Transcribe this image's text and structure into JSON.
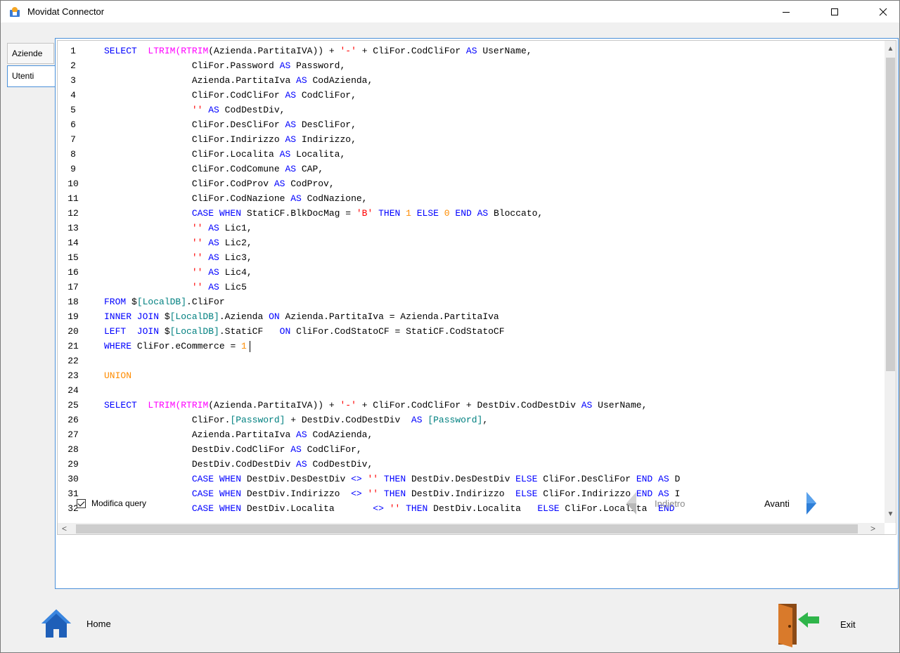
{
  "window": {
    "title": "Movidat Connector",
    "minimize_glyph": "—",
    "maximize_glyph": "☐",
    "close_glyph": "✕"
  },
  "tabs": [
    {
      "label": "Aziende"
    },
    {
      "label": "Utenti"
    }
  ],
  "editor": {
    "lines": [
      {
        "n": "1"
      },
      {
        "n": "2"
      },
      {
        "n": "3"
      },
      {
        "n": "4"
      },
      {
        "n": "5"
      },
      {
        "n": "6"
      },
      {
        "n": "7"
      },
      {
        "n": "8"
      },
      {
        "n": "9"
      },
      {
        "n": "10"
      },
      {
        "n": "11"
      },
      {
        "n": "12"
      },
      {
        "n": "13"
      },
      {
        "n": "14"
      },
      {
        "n": "15"
      },
      {
        "n": "16"
      },
      {
        "n": "17"
      },
      {
        "n": "18"
      },
      {
        "n": "19"
      },
      {
        "n": "20"
      },
      {
        "n": "21"
      },
      {
        "n": "22"
      },
      {
        "n": "23"
      },
      {
        "n": "24"
      },
      {
        "n": "25"
      },
      {
        "n": "26"
      },
      {
        "n": "27"
      },
      {
        "n": "28"
      },
      {
        "n": "29"
      },
      {
        "n": "30"
      },
      {
        "n": "31"
      },
      {
        "n": "32"
      }
    ],
    "code": [
      [
        [
          "kw",
          "SELECT"
        ],
        [
          "",
          "  "
        ],
        [
          "fn",
          "LTRIM"
        ],
        [
          "",
          ""
        ],
        [
          "fn",
          "(RTRIM"
        ],
        [
          "",
          "(Azienda.PartitaIVA)) + "
        ],
        [
          "str",
          "'-'"
        ],
        [
          "",
          " + CliFor.CodCliFor "
        ],
        [
          "kw",
          "AS"
        ],
        [
          "",
          " UserName,"
        ]
      ],
      [
        [
          "",
          "                CliFor.Password "
        ],
        [
          "kw",
          "AS"
        ],
        [
          "",
          " Password,"
        ]
      ],
      [
        [
          "",
          "                Azienda.PartitaIva "
        ],
        [
          "kw",
          "AS"
        ],
        [
          "",
          " CodAzienda,"
        ]
      ],
      [
        [
          "",
          "                CliFor.CodCliFor "
        ],
        [
          "kw",
          "AS"
        ],
        [
          "",
          " CodCliFor,"
        ]
      ],
      [
        [
          "",
          "                "
        ],
        [
          "str",
          "''"
        ],
        [
          "",
          " "
        ],
        [
          "kw",
          "AS"
        ],
        [
          "",
          " CodDestDiv,"
        ]
      ],
      [
        [
          "",
          "                CliFor.DesCliFor "
        ],
        [
          "kw",
          "AS"
        ],
        [
          "",
          " DesCliFor,"
        ]
      ],
      [
        [
          "",
          "                CliFor.Indirizzo "
        ],
        [
          "kw",
          "AS"
        ],
        [
          "",
          " Indirizzo,"
        ]
      ],
      [
        [
          "",
          "                CliFor.Localita "
        ],
        [
          "kw",
          "AS"
        ],
        [
          "",
          " Localita,"
        ]
      ],
      [
        [
          "",
          "                CliFor.CodComune "
        ],
        [
          "kw",
          "AS"
        ],
        [
          "",
          " CAP,"
        ]
      ],
      [
        [
          "",
          "                CliFor.CodProv "
        ],
        [
          "kw",
          "AS"
        ],
        [
          "",
          " CodProv,"
        ]
      ],
      [
        [
          "",
          "                CliFor.CodNazione "
        ],
        [
          "kw",
          "AS"
        ],
        [
          "",
          " CodNazione,"
        ]
      ],
      [
        [
          "",
          "                "
        ],
        [
          "kw",
          "CASE WHEN"
        ],
        [
          "",
          " StatiCF.BlkDocMag = "
        ],
        [
          "str",
          "'B'"
        ],
        [
          "",
          " "
        ],
        [
          "kw",
          "THEN"
        ],
        [
          "",
          " "
        ],
        [
          "num",
          "1"
        ],
        [
          "",
          " "
        ],
        [
          "kw",
          "ELSE"
        ],
        [
          "",
          " "
        ],
        [
          "num",
          "0"
        ],
        [
          "",
          " "
        ],
        [
          "kw",
          "END AS"
        ],
        [
          "",
          " Bloccato,"
        ]
      ],
      [
        [
          "",
          "                "
        ],
        [
          "str",
          "''"
        ],
        [
          "",
          " "
        ],
        [
          "kw",
          "AS"
        ],
        [
          "",
          " Lic1,"
        ]
      ],
      [
        [
          "",
          "                "
        ],
        [
          "str",
          "''"
        ],
        [
          "",
          " "
        ],
        [
          "kw",
          "AS"
        ],
        [
          "",
          " Lic2,"
        ]
      ],
      [
        [
          "",
          "                "
        ],
        [
          "str",
          "''"
        ],
        [
          "",
          " "
        ],
        [
          "kw",
          "AS"
        ],
        [
          "",
          " Lic3,"
        ]
      ],
      [
        [
          "",
          "                "
        ],
        [
          "str",
          "''"
        ],
        [
          "",
          " "
        ],
        [
          "kw",
          "AS"
        ],
        [
          "",
          " Lic4,"
        ]
      ],
      [
        [
          "",
          "                "
        ],
        [
          "str",
          "''"
        ],
        [
          "",
          " "
        ],
        [
          "kw",
          "AS"
        ],
        [
          "",
          " Lic5"
        ]
      ],
      [
        [
          "kw",
          "FROM"
        ],
        [
          "",
          " $"
        ],
        [
          "var",
          "[LocalDB]"
        ],
        [
          "",
          ".CliFor"
        ]
      ],
      [
        [
          "kw",
          "INNER JOIN"
        ],
        [
          "",
          " $"
        ],
        [
          "var",
          "[LocalDB]"
        ],
        [
          "",
          ".Azienda "
        ],
        [
          "kw",
          "ON"
        ],
        [
          "",
          " Azienda.PartitaIva = Azienda.PartitaIva"
        ]
      ],
      [
        [
          "kw",
          "LEFT  JOIN"
        ],
        [
          "",
          " $"
        ],
        [
          "var",
          "[LocalDB]"
        ],
        [
          "",
          ".StatiCF   "
        ],
        [
          "kw",
          "ON"
        ],
        [
          "",
          " CliFor.CodStatoCF = StatiCF.CodStatoCF"
        ]
      ],
      [
        [
          "kw",
          "WHERE"
        ],
        [
          "",
          " CliFor.eCommerce = "
        ],
        [
          "num",
          "1"
        ]
      ],
      [],
      [
        [
          "num",
          "UNION"
        ]
      ],
      [],
      [
        [
          "kw",
          "SELECT"
        ],
        [
          "",
          "  "
        ],
        [
          "fn",
          "LTRIM"
        ],
        [
          "fn",
          "(RTRIM"
        ],
        [
          "",
          "(Azienda.PartitaIVA)) + "
        ],
        [
          "str",
          "'-'"
        ],
        [
          "",
          " + CliFor.CodCliFor + DestDiv.CodDestDiv "
        ],
        [
          "kw",
          "AS"
        ],
        [
          "",
          " UserName,"
        ]
      ],
      [
        [
          "",
          "                CliFor."
        ],
        [
          "var",
          "[Password]"
        ],
        [
          "",
          " + DestDiv.CodDestDiv  "
        ],
        [
          "kw",
          "AS"
        ],
        [
          "",
          " "
        ],
        [
          "var",
          "[Password]"
        ],
        [
          "",
          ","
        ]
      ],
      [
        [
          "",
          "                Azienda.PartitaIva "
        ],
        [
          "kw",
          "AS"
        ],
        [
          "",
          " CodAzienda,"
        ]
      ],
      [
        [
          "",
          "                DestDiv.CodCliFor "
        ],
        [
          "kw",
          "AS"
        ],
        [
          "",
          " CodCliFor,"
        ]
      ],
      [
        [
          "",
          "                DestDiv.CodDestDiv "
        ],
        [
          "kw",
          "AS"
        ],
        [
          "",
          " CodDestDiv,"
        ]
      ],
      [
        [
          "",
          "                "
        ],
        [
          "kw",
          "CASE WHEN"
        ],
        [
          "",
          " DestDiv.DesDestDiv "
        ],
        [
          "kw",
          "<>"
        ],
        [
          "",
          " "
        ],
        [
          "str",
          "''"
        ],
        [
          "",
          " "
        ],
        [
          "kw",
          "THEN"
        ],
        [
          "",
          " DestDiv.DesDestDiv "
        ],
        [
          "kw",
          "ELSE"
        ],
        [
          "",
          " CliFor.DesCliFor "
        ],
        [
          "kw",
          "END AS"
        ],
        [
          "",
          " D"
        ]
      ],
      [
        [
          "",
          "                "
        ],
        [
          "kw",
          "CASE WHEN"
        ],
        [
          "",
          " DestDiv.Indirizzo  "
        ],
        [
          "kw",
          "<>"
        ],
        [
          "",
          " "
        ],
        [
          "str",
          "''"
        ],
        [
          "",
          " "
        ],
        [
          "kw",
          "THEN"
        ],
        [
          "",
          " DestDiv.Indirizzo  "
        ],
        [
          "kw",
          "ELSE"
        ],
        [
          "",
          " CliFor.Indirizzo "
        ],
        [
          "kw",
          "END AS"
        ],
        [
          "",
          " I"
        ]
      ],
      [
        [
          "",
          "                "
        ],
        [
          "kw",
          "CASE WHEN"
        ],
        [
          "",
          " DestDiv.Localita       "
        ],
        [
          "kw",
          "<>"
        ],
        [
          "",
          " "
        ],
        [
          "str",
          "''"
        ],
        [
          "",
          " "
        ],
        [
          "kw",
          "THEN"
        ],
        [
          "",
          " DestDiv.Localita   "
        ],
        [
          "kw",
          "ELSE"
        ],
        [
          "",
          " CliFor.Localita  "
        ],
        [
          "kw",
          "END"
        ]
      ]
    ]
  },
  "footer": {
    "modifica_query_label": "Modifica query",
    "modifica_query_checked": true,
    "back_label": "Indietro",
    "next_label": "Avanti"
  },
  "bottom": {
    "home_label": "Home",
    "exit_label": "Exit"
  },
  "colors": {
    "keyword": "#0000ff",
    "function": "#ff00ff",
    "string": "#ff0000",
    "number": "#ff8c00",
    "variable": "#008080",
    "accent": "#4a90d9"
  },
  "icons": [
    "app-icon",
    "minimize-icon",
    "maximize-icon",
    "close-icon",
    "arrow-up-icon",
    "arrow-down-icon",
    "arrow-left-icon",
    "arrow-right-icon",
    "back-arrow-icon",
    "next-arrow-icon",
    "home-icon",
    "exit-door-icon"
  ]
}
